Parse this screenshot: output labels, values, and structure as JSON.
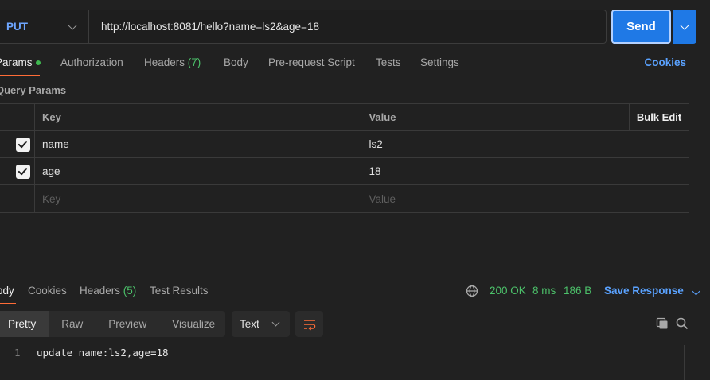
{
  "request": {
    "method": "PUT",
    "url": "http://localhost:8081/hello?name=ls2&age=18",
    "send_label": "Send"
  },
  "request_tabs": {
    "params": "Params",
    "authorization": "Authorization",
    "headers": "Headers",
    "headers_count": "(7)",
    "body": "Body",
    "prerequest": "Pre-request Script",
    "tests": "Tests",
    "settings": "Settings",
    "cookies": "Cookies"
  },
  "query_params": {
    "title": "Query Params",
    "col_key": "Key",
    "col_value": "Value",
    "bulk_edit": "Bulk Edit",
    "rows": [
      {
        "key": "name",
        "value": "ls2",
        "checked": true
      },
      {
        "key": "age",
        "value": "18",
        "checked": true
      }
    ],
    "key_placeholder": "Key",
    "value_placeholder": "Value"
  },
  "response_tabs": {
    "body": "Body",
    "cookies": "Cookies",
    "headers": "Headers",
    "headers_count": "(5)",
    "test_results": "Test Results"
  },
  "response_status": {
    "status": "200 OK",
    "time": "8 ms",
    "size": "186 B",
    "save_response": "Save Response"
  },
  "format": {
    "pretty": "Pretty",
    "raw": "Raw",
    "preview": "Preview",
    "visualize": "Visualize",
    "type": "Text"
  },
  "response_body": {
    "line_number": "1",
    "content": "update name:ls2,age=18"
  },
  "colors": {
    "accent": "#ff6c37",
    "send_blue": "#1f79e6",
    "status_green": "#4cc16a"
  }
}
